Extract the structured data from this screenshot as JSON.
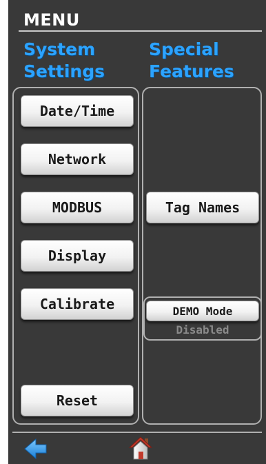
{
  "menu": {
    "title": "MENU"
  },
  "left_column": {
    "header_line1": "System",
    "header_line2": "Settings",
    "buttons": [
      "Date/Time",
      "Network",
      "MODBUS",
      "Display",
      "Calibrate",
      "Reset"
    ]
  },
  "right_column": {
    "header_line1": "Special",
    "header_line2": "Features",
    "tag_names_label": "Tag Names",
    "demo_mode": {
      "label": "DEMO Mode",
      "status": "Disabled"
    }
  },
  "nav": {
    "back_icon": "back-arrow-icon",
    "home_icon": "home-icon"
  },
  "colors": {
    "background": "#393939",
    "header_accent": "#2ca3ff",
    "status_text": "#8a8a8a"
  }
}
